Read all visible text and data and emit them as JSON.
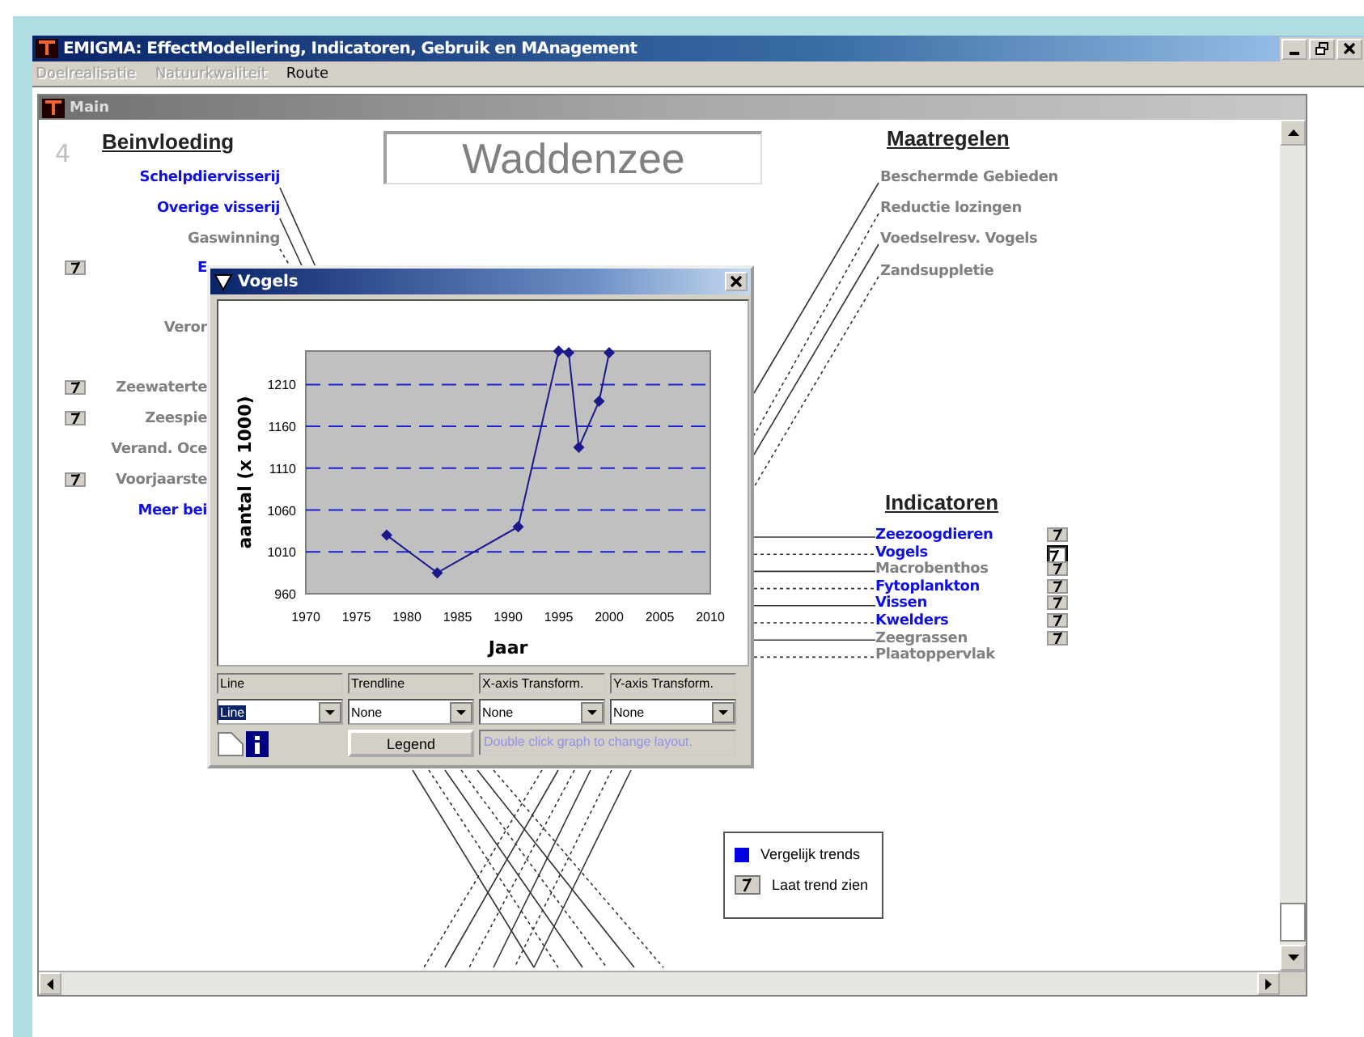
{
  "window": {
    "title": "EMIGMA: EffectModellering, Indicatoren, Gebruik en MAnagement"
  },
  "menu": [
    {
      "label": "Doelrealisatie",
      "disabled": true
    },
    {
      "label": "Natuurkwaliteit",
      "disabled": true
    },
    {
      "label": "Route",
      "disabled": false
    }
  ],
  "main": {
    "title": "Main",
    "page_number": "4",
    "area": "Waddenzee",
    "influences": {
      "heading": "Beinvloeding",
      "items": [
        {
          "label": "Schelpdiervisserij",
          "active": true,
          "trend": false
        },
        {
          "label": "Overige visserij",
          "active": true,
          "trend": false
        },
        {
          "label": "Gaswinning",
          "active": false,
          "trend": false
        },
        {
          "label": "E",
          "active": true,
          "trend": true
        },
        {
          "label": "Veror",
          "active": false,
          "trend": false
        },
        {
          "label": "Zeewaterte",
          "active": false,
          "trend": true
        },
        {
          "label": "Zeespie",
          "active": false,
          "trend": true
        },
        {
          "label": "Verand. Oce",
          "active": false,
          "trend": false
        },
        {
          "label": "Voorjaarste",
          "active": false,
          "trend": true
        },
        {
          "label": "Meer bei",
          "active": true,
          "trend": false
        }
      ]
    },
    "measures": {
      "heading": "Maatregelen",
      "items": [
        {
          "label": "Beschermde Gebieden"
        },
        {
          "label": "Reductie lozingen"
        },
        {
          "label": "Voedselresv. Vogels"
        },
        {
          "label": "Zandsuppletie"
        }
      ]
    },
    "indicators": {
      "heading": "Indicatoren",
      "items": [
        {
          "label": "Zeezoogdieren",
          "active": true,
          "trend": true,
          "selected": false
        },
        {
          "label": "Vogels",
          "active": true,
          "trend": true,
          "selected": true
        },
        {
          "label": "Macrobenthos",
          "active": false,
          "trend": true,
          "selected": false
        },
        {
          "label": "Fytoplankton",
          "active": true,
          "trend": true,
          "selected": false
        },
        {
          "label": "Vissen",
          "active": true,
          "trend": true,
          "selected": false
        },
        {
          "label": "Kwelders",
          "active": true,
          "trend": true,
          "selected": false
        },
        {
          "label": "Zeegrassen",
          "active": false,
          "trend": true,
          "selected": false
        },
        {
          "label": "Plaatoppervlak",
          "active": false,
          "trend": false,
          "selected": false
        }
      ]
    },
    "legend": [
      {
        "kind": "compare",
        "label": "Vergelijk trends"
      },
      {
        "kind": "trend",
        "label": "Laat trend zien"
      }
    ]
  },
  "dialog": {
    "title": "Vogels",
    "chart_data": {
      "type": "line",
      "xlabel": "Jaar",
      "ylabel": "aantal (x 1000)",
      "x": [
        1978,
        1983,
        1991,
        1995,
        1996,
        1997,
        1999,
        2000
      ],
      "grid": true,
      "series": [
        {
          "color": "#1a1a8c",
          "marker": "diamond",
          "values": [
            1030,
            985,
            1040,
            1250,
            1248,
            1135,
            1190,
            1248
          ]
        }
      ],
      "xlim": [
        1970,
        2010
      ],
      "ylim": [
        960,
        1250
      ],
      "xticks": [
        1970,
        1975,
        1980,
        1985,
        1990,
        1995,
        2000,
        2005,
        2010
      ],
      "yticks": [
        960,
        1010,
        1060,
        1110,
        1160,
        1210
      ]
    },
    "controls": [
      {
        "label": "Line",
        "value": "Line",
        "focused": true
      },
      {
        "label": "Trendline",
        "value": "None",
        "focused": false
      },
      {
        "label": "X-axis Transform.",
        "value": "None",
        "focused": false
      },
      {
        "label": "Y-axis Transform.",
        "value": "None",
        "focused": false
      }
    ],
    "legend_button": "Legend",
    "hint": "Double click graph to change layout."
  }
}
